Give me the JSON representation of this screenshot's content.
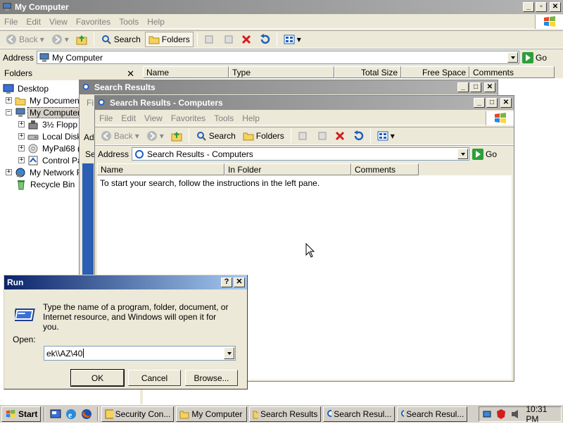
{
  "main_window": {
    "title": "My Computer",
    "menu": [
      "File",
      "Edit",
      "View",
      "Favorites",
      "Tools",
      "Help"
    ],
    "toolbar": {
      "back": "Back",
      "search": "Search",
      "folders": "Folders"
    },
    "address_label": "Address",
    "address_value": "My Computer",
    "go_label": "Go",
    "folders_pane_title": "Folders",
    "tree": [
      {
        "label": "Desktop",
        "icon": "desktop-icon"
      },
      {
        "label": "My Document",
        "icon": "folder-icon"
      },
      {
        "label": "My Computer",
        "icon": "computer-icon"
      },
      {
        "label": "3½ Flopp",
        "icon": "floppy-icon"
      },
      {
        "label": "Local Disk",
        "icon": "drive-icon"
      },
      {
        "label": "MyPal68 (",
        "icon": "cdrom-icon"
      },
      {
        "label": "Control Pa",
        "icon": "control-panel-icon"
      },
      {
        "label": "My Network P",
        "icon": "network-icon"
      },
      {
        "label": "Recycle Bin",
        "icon": "recycle-bin-icon"
      }
    ],
    "columns": [
      "Name",
      "Type",
      "Total Size",
      "Free Space",
      "Comments"
    ]
  },
  "search_window_back": {
    "title": "Search Results",
    "peek_fi": "Fi",
    "peek_ad": "Ad",
    "peek_se": "Se"
  },
  "search_window_front": {
    "title": "Search Results - Computers",
    "menu": [
      "File",
      "Edit",
      "View",
      "Favorites",
      "Tools",
      "Help"
    ],
    "toolbar": {
      "back": "Back",
      "search": "Search",
      "folders": "Folders"
    },
    "address_label": "Address",
    "address_value": "Search Results - Computers",
    "go_label": "Go",
    "columns": [
      "Name",
      "In Folder",
      "Comments"
    ],
    "message": "To start your search, follow the instructions in the left pane."
  },
  "run_dialog": {
    "title": "Run",
    "help_btn": "?",
    "close_btn": "✕",
    "description": "Type the name of a program, folder, document, or Internet resource, and Windows will open it for you.",
    "open_label": "Open:",
    "open_value": "ek\\\\AZ\\40",
    "ok": "OK",
    "cancel": "Cancel",
    "browse": "Browse..."
  },
  "taskbar": {
    "start": "Start",
    "tasks": [
      "Security Con...",
      "My Computer",
      "Search Results",
      "Search Resul...",
      "Search Resul..."
    ],
    "clock": "10:31 PM"
  }
}
